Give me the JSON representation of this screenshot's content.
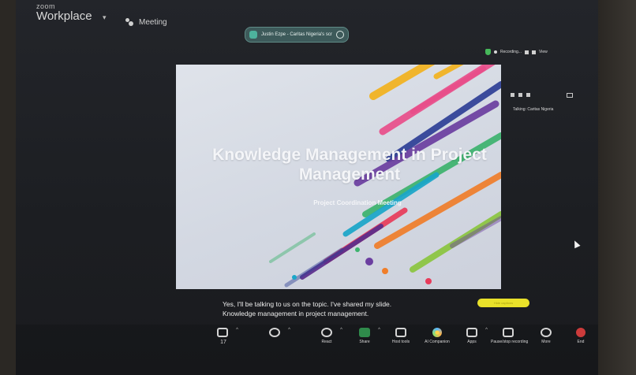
{
  "app": {
    "brand_small": "zoom",
    "brand_big": "Workplace",
    "meeting_tab": "Meeting",
    "brand_caret": "▾"
  },
  "share_banner": {
    "text": "Justin Ezpe - Caritas Nigeria's scr"
  },
  "status": {
    "recording_text": "Recording...",
    "view_label": "View"
  },
  "slide": {
    "title": "Knowledge Management in Project Management",
    "subtitle": "Project Coordination Meeting",
    "stripe_colors": [
      "#f3b21e",
      "#e94e8a",
      "#2e3f96",
      "#6b3ea0",
      "#3db36e",
      "#f07e2a",
      "#1aa6c9",
      "#e83b5a",
      "#8bc53f",
      "#5a2d8c"
    ]
  },
  "side_panel": {
    "talking_label": "Talking: Caritas Nigeria"
  },
  "caption": {
    "line1": "Yes, I'll be talking to us on the topic. I've shared my slide.",
    "line2": "Knowledge management in project management."
  },
  "yellow_button": {
    "label": "Hide captions"
  },
  "toolbar": {
    "participants_count": "17",
    "items": [
      {
        "label": "Participants"
      },
      {
        "label": "Chat"
      },
      {
        "label": "React"
      },
      {
        "label": "Share"
      },
      {
        "label": "Host tools"
      },
      {
        "label": "AI Companion"
      },
      {
        "label": "Apps"
      },
      {
        "label": "Pause/stop recording"
      },
      {
        "label": "More"
      },
      {
        "label": "End"
      }
    ]
  },
  "colors": {
    "screen_bg": "#1d1f23",
    "share_pill": "#3d5a5a",
    "share_icon": "#2f8b4b",
    "highlight_yellow": "#e9e12a",
    "end_red": "#cc3b3b",
    "shield_green": "#46b85a"
  }
}
